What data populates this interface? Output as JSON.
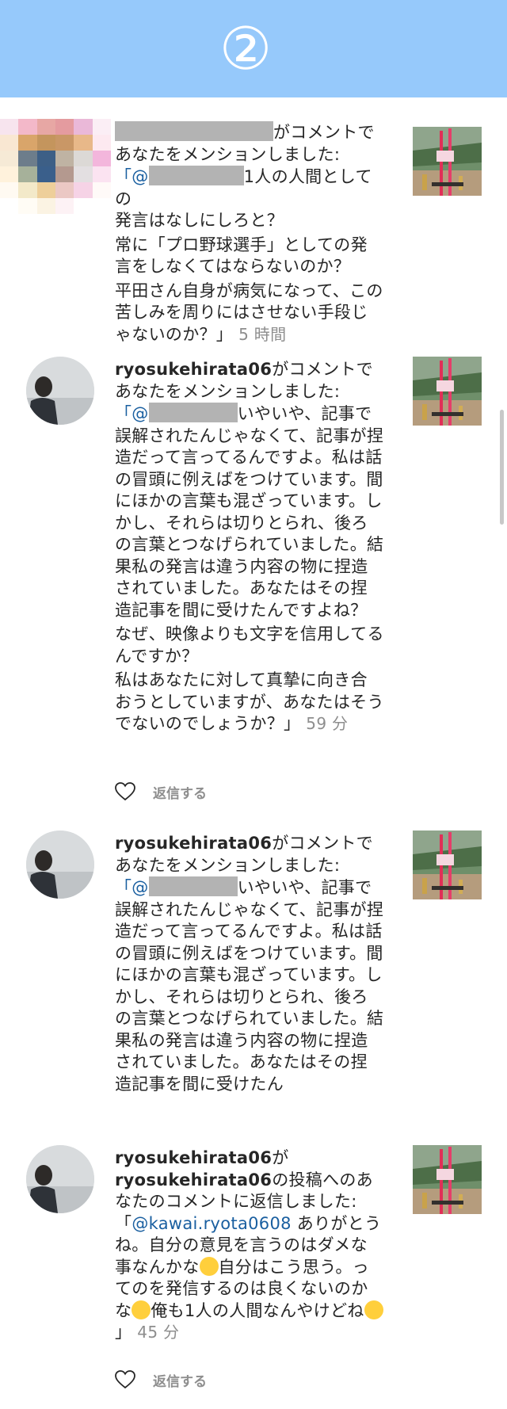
{
  "header": {
    "number": "②",
    "bg_color": "#96c9fb"
  },
  "items": [
    {
      "avatar": "blurred-avatar",
      "notice_suffix": "がコメントで",
      "notice_line2": "あなたをメンションしました:",
      "quote_open": "「@",
      "body_line1_tail": "1人の人間としての",
      "body_rest1": "発言はなしにしろと？",
      "body_p2": "常に「プロ野球選手」としての発言をしなくてはならないのか？",
      "body_p3": "平田さん自身が病気になって、この苦しみを周りにはさせない手段じゃないのか？」",
      "time": "5 時間"
    },
    {
      "username": "ryosukehirata06",
      "notice_suffix": "がコメントで",
      "notice_line2": "あなたをメンションしました:",
      "quote_open": "「@",
      "body_line1_tail": "いやいや、記事で",
      "body_p1": "誤解されたんじゃなくて、記事が捏造だって言ってるんですよ。私は話の冒頭に例えばをつけています。間にほかの言葉も混ざっています。しかし、それらは切りとられ、後ろの言葉とつなげられていました。結果私の発言は違う内容の物に捏造されていました。あなたはその捏造記事を間に受けたんですよね？",
      "body_p2": "なぜ、映像よりも文字を信用してるんですか？",
      "body_p3": "私はあなたに対して真摯に向き合おうとしていますが、あなたはそうでないのでしょうか？」",
      "time": "59 分",
      "reply_label": "返信する"
    },
    {
      "username": "ryosukehirata06",
      "notice_suffix": "がコメントで",
      "notice_line2": "あなたをメンションしました:",
      "quote_open": "「@",
      "body_line1_tail": "いやいや、記事で",
      "body_p1": "誤解されたんじゃなくて、記事が捏造だって言ってるんですよ。私は話の冒頭に例えばをつけています。間にほかの言葉も混ざっています。しかし、それらは切りとられ、後ろの言葉とつなげられていました。結果私の発言は違う内容の物に捏造されていました。あなたはその捏造記事を間に受けたん"
    },
    {
      "username": "ryosukehirata06",
      "notice_suffix": "が",
      "notice_owner": "ryosukehirata06",
      "notice_rest": "の投稿へのあなたのコメントに返信しました:",
      "quote_open": "「",
      "mention": "@kawai.ryota0608",
      "body_a": " ありがとうね。自分の意見を言うのはダメな事なんかな",
      "body_b": "自分はこう思う。ってのを発信するのは良くないのかな",
      "body_c": "俺も1人の人間なんやけどね",
      "body_d": "」",
      "time": "45 分",
      "reply_label": "返信する"
    }
  ]
}
